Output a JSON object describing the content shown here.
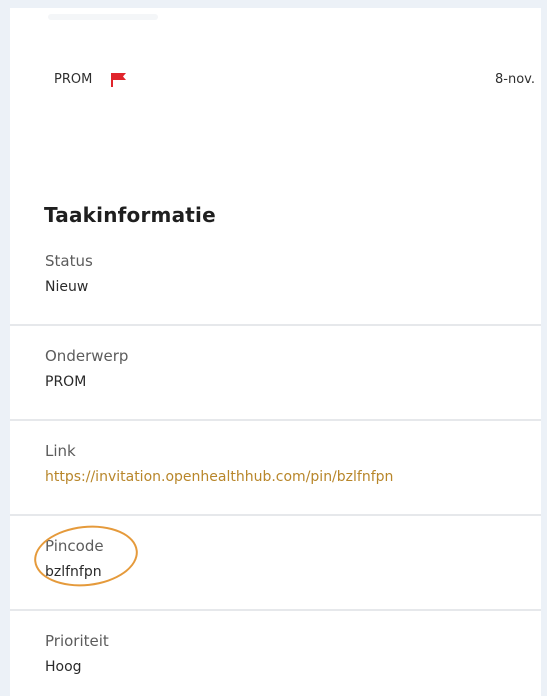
{
  "task": {
    "type": "PROM",
    "date": "8-nov."
  },
  "section_title": "Taakinformatie",
  "fields": [
    {
      "label": "Status",
      "value": "Nieuw"
    },
    {
      "label": "Onderwerp",
      "value": "PROM"
    },
    {
      "label": "Link",
      "value": "https://invitation.openhealthhub.com/pin/bzlfnfpn"
    },
    {
      "label": "Pincode",
      "value": "bzlfnfpn"
    },
    {
      "label": "Prioriteit",
      "value": "Hoog"
    }
  ],
  "icons": {
    "flag": "flag-icon"
  },
  "colors": {
    "link": "#b8862a",
    "flag": "#e0242b",
    "annotation": "#e59a3b",
    "page_background": "#ecf1f7",
    "divider": "#e6e8eb"
  }
}
